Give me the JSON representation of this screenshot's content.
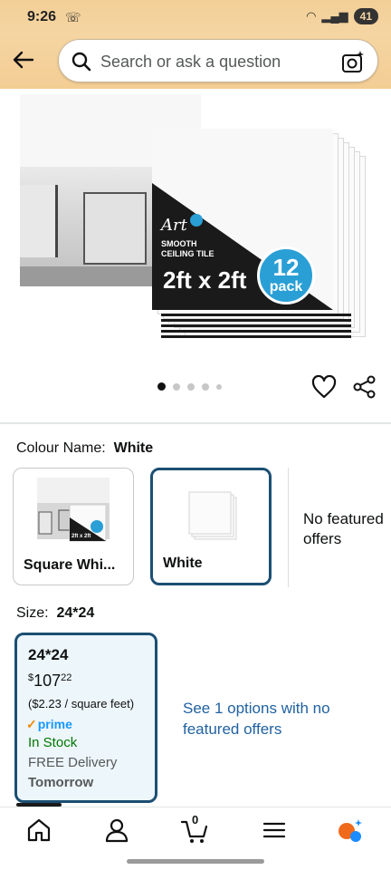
{
  "status_bar": {
    "time": "9:26",
    "battery": "41"
  },
  "search": {
    "placeholder": "Search or ask a question"
  },
  "hero": {
    "brand": "Art",
    "tag_line1": "SMOOTH",
    "tag_line2": "CEILING TILE",
    "product_size": "2ft x 2ft",
    "pack_count": "12",
    "pack_word": "pack",
    "carousel_dots": 5,
    "active_dot": 0
  },
  "colour": {
    "label": "Colour Name:",
    "selected": "White",
    "options": [
      {
        "label": "Square Whi...",
        "thumb_text": "2ft x 2ft"
      },
      {
        "label": "White"
      }
    ],
    "no_featured": "No featured offers"
  },
  "size": {
    "label": "Size:",
    "selected": "24*24",
    "card": {
      "title": "24*24",
      "currency": "$",
      "price_whole": "107",
      "price_fraction": "22",
      "unit_price": "($2.23 / square feet)",
      "prime": "prime",
      "stock": "In Stock",
      "delivery": "FREE Delivery",
      "delivery_day": "Tomorrow"
    },
    "see_options": "See 1 options with no featured offers"
  },
  "bottom_nav": {
    "cart_count": "0"
  },
  "colors": {
    "header": "#f3cd94",
    "selected_border": "#1b4f72",
    "link": "#2162a1",
    "stock": "#007600"
  }
}
